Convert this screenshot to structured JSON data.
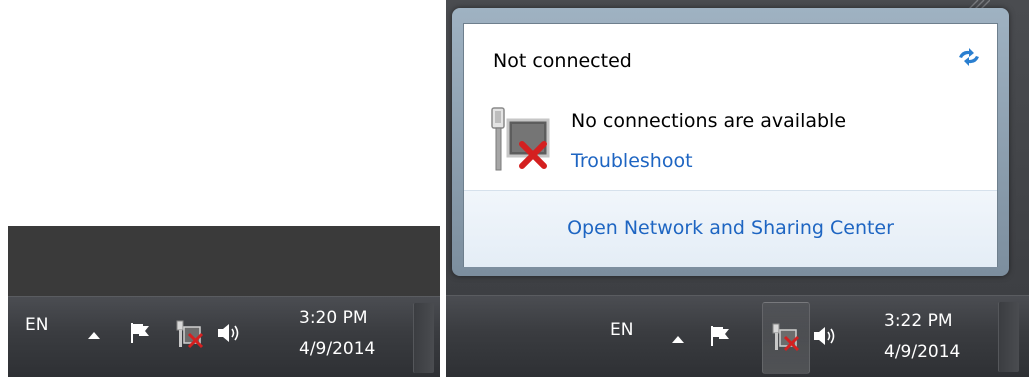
{
  "left_screenshot": {
    "tray": {
      "language": "EN",
      "time": "3:20 PM",
      "date": "4/9/2014"
    }
  },
  "right_screenshot": {
    "flyout": {
      "status_title": "Not connected",
      "message": "No connections are available",
      "troubleshoot_link": "Troubleshoot",
      "network_center_link": "Open Network and Sharing Center"
    },
    "tray": {
      "language": "EN",
      "time": "3:22 PM",
      "date": "4/9/2014"
    }
  },
  "icons": {
    "show_hidden": "show-hidden-icons-arrow-icon",
    "action_center": "flag-icon",
    "network": "network-disconnected-icon",
    "volume": "speaker-icon",
    "refresh": "refresh-icon"
  },
  "colors": {
    "taskbar": "#3a3c40",
    "link": "#1e65c2",
    "error_x": "#d42020"
  }
}
